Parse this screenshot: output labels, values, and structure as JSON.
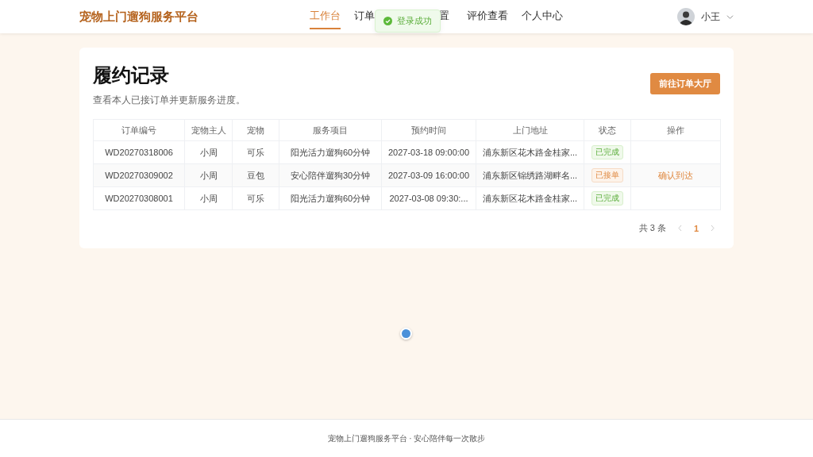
{
  "header": {
    "brand": "宠物上门遛狗服务平台",
    "nav": [
      {
        "label": "工作台",
        "selected": true
      },
      {
        "label": "订单",
        "selected": false
      },
      {
        "label": "置",
        "selected": false
      },
      {
        "label": "评价查看",
        "selected": false
      },
      {
        "label": "个人中心",
        "selected": false
      }
    ],
    "user": {
      "name": "小王"
    }
  },
  "toast": {
    "text": "登录成功"
  },
  "page": {
    "title": "履约记录",
    "subtitle": "查看本人已接订单并更新服务进度。",
    "action_button": "前往订单大厅"
  },
  "table": {
    "columns": [
      "订单编号",
      "宠物主人",
      "宠物",
      "服务项目",
      "预约时间",
      "上门地址",
      "状态",
      "操作"
    ],
    "rows": [
      {
        "order_no": "WD20270318006",
        "owner": "小周",
        "pet": "可乐",
        "service": "阳光活力遛狗60分钟",
        "time": "2027-03-18 09:00:00",
        "address": "浦东新区花木路金桂家...",
        "status": {
          "label": "已完成",
          "kind": "done"
        }
      },
      {
        "order_no": "WD20270309002",
        "owner": "小周",
        "pet": "豆包",
        "service": "安心陪伴遛狗30分钟",
        "time": "2027-03-09 16:00:00",
        "address": "浦东新区锦绣路湖畔名...",
        "status": {
          "label": "已接单",
          "kind": "accepted"
        },
        "action": "确认到达"
      },
      {
        "order_no": "WD20270308001",
        "owner": "小周",
        "pet": "可乐",
        "service": "阳光活力遛狗60分钟",
        "time": "2027-03-08 09:30:...",
        "address": "浦东新区花木路金桂家...",
        "status": {
          "label": "已完成",
          "kind": "done"
        }
      }
    ]
  },
  "pagination": {
    "total": "共 3 条",
    "prev_disabled": true,
    "next_disabled": true,
    "pages": [
      {
        "label": "1",
        "selected": true
      }
    ]
  },
  "footer": {
    "text": "宠物上门遛狗服务平台 · 安心陪伴每一次散步"
  }
}
